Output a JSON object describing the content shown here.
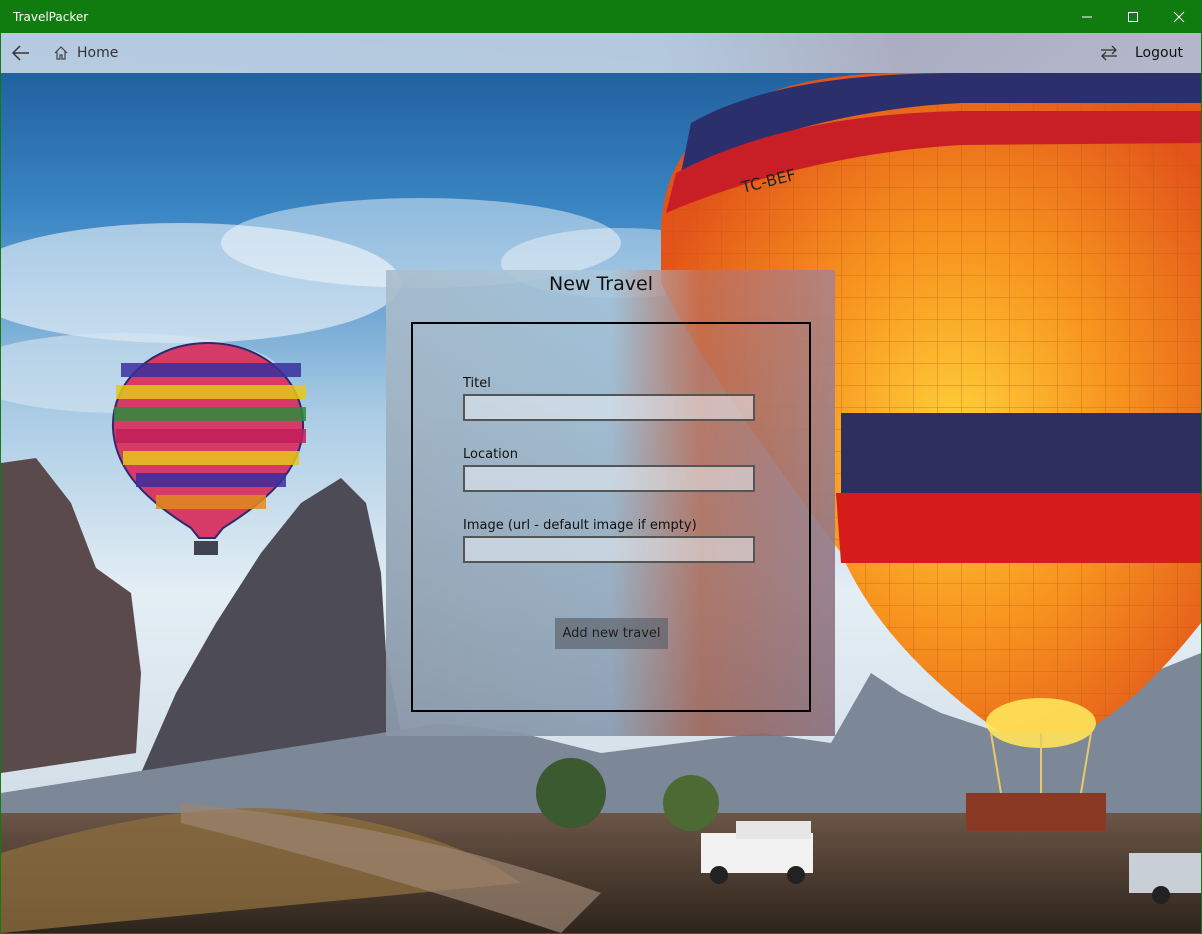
{
  "window": {
    "title": "TravelPacker"
  },
  "nav": {
    "home_label": "Home",
    "logout_label": "Logout"
  },
  "form": {
    "title": "New Travel",
    "fields": [
      {
        "label": "Titel",
        "value": ""
      },
      {
        "label": "Location",
        "value": ""
      },
      {
        "label": "Image (url - default image if empty)",
        "value": ""
      }
    ],
    "submit_label": "Add new travel"
  },
  "colors": {
    "titlebar": "#107c10",
    "balloon_red": "#d51f1f",
    "balloon_orange": "#f39a1c"
  },
  "scene": {
    "balloon_label": "TC-BEF"
  }
}
